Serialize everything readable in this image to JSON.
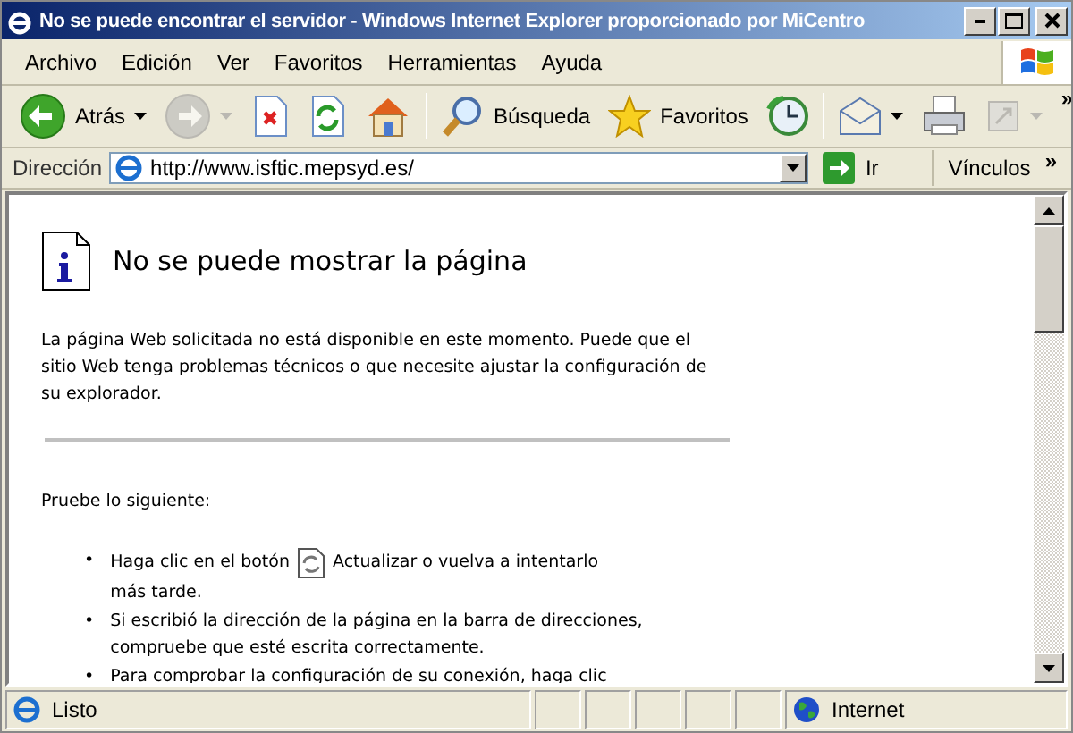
{
  "window": {
    "title": "No se puede encontrar el servidor - Windows Internet Explorer proporcionado por MiCentro"
  },
  "menu": [
    {
      "label": "Archivo"
    },
    {
      "label": "Edición"
    },
    {
      "label": "Ver"
    },
    {
      "label": "Favoritos"
    },
    {
      "label": "Herramientas"
    },
    {
      "label": "Ayuda"
    }
  ],
  "toolbar": [
    {
      "kind": "back",
      "label": "Atrás",
      "disabled": false,
      "dropdown": true
    },
    {
      "kind": "forward",
      "disabled": true,
      "dropdown": true
    },
    {
      "kind": "stop",
      "disabled": false,
      "dropdown": false
    },
    {
      "kind": "refresh",
      "disabled": false,
      "dropdown": false
    },
    {
      "kind": "home",
      "disabled": false,
      "dropdown": false
    },
    {
      "kind": "search",
      "label": "Búsqueda",
      "disabled": false,
      "dropdown": false
    },
    {
      "kind": "favorites",
      "label": "Favoritos",
      "disabled": false,
      "dropdown": false
    },
    {
      "kind": "history",
      "disabled": false,
      "dropdown": false
    },
    {
      "kind": "mail",
      "disabled": false,
      "dropdown": true
    },
    {
      "kind": "print",
      "disabled": false,
      "dropdown": false
    },
    {
      "kind": "edit",
      "disabled": true,
      "dropdown": true
    }
  ],
  "toolbar_overflow": "»",
  "address": {
    "label": "Dirección",
    "value": "http://www.isftic.mepsyd.es/",
    "go": "Ir",
    "links": "Vínculos",
    "links_overflow": "»"
  },
  "page": {
    "heading": "No se puede mostrar la página",
    "intro": "La página Web solicitada no está disponible en este momento. Puede que el sitio Web tenga problemas técnicos o que necesite ajustar la configuración de su explorador.",
    "try_label": "Pruebe lo siguiente:",
    "items": [
      {
        "kind": "button",
        "bullet": "•",
        "before": "Haga clic en el botón",
        "after": "Actualizar o vuelva a intentarlo",
        "after_continued": "más tarde."
      },
      {
        "kind": "text",
        "bullet": "•",
        "text": "Si escribió la dirección de la página en la barra de direcciones, compruebe que esté escrita correctamente."
      },
      {
        "kind": "text",
        "bullet": "•",
        "text": "Para comprobar la configuración de su conexión, haga clic"
      }
    ]
  },
  "status_bar": {
    "text": "Listo",
    "zone": "Internet"
  }
}
